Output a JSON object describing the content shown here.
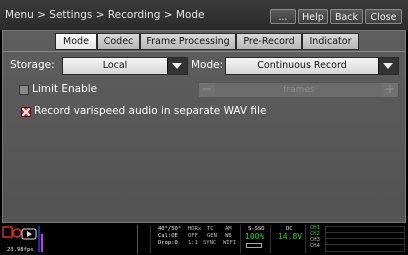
{
  "header": {
    "breadcrumb": "Menu > Settings > Recording > Mode",
    "buttons": {
      "more": "...",
      "help": "Help",
      "back": "Back",
      "close": "Close"
    }
  },
  "tabs": [
    "Mode",
    "Codec",
    "Frame Processing",
    "Pre-Record",
    "Indicator"
  ],
  "active_tab": "Mode",
  "form": {
    "storage_label": "Storage:",
    "storage_value": "Local",
    "mode_label": "Mode:",
    "mode_value": "Continuous Record",
    "limit_enable_label": "Limit Enable",
    "limit_enable_checked": false,
    "frames_placeholder": "frames",
    "frames_minus": "−",
    "frames_plus": "+",
    "varispeed_label": "Record varispeed audio in separate WAV file",
    "varispeed_checked": true
  },
  "status": {
    "timecode_label": "23.98fps",
    "iso": "40°/50°",
    "cal": "Cal:OE",
    "drop": "Drop:0",
    "hdrx": "HDRx",
    "tc": "TC",
    "am": "AM",
    "off": "OFF",
    "gen": "GEN",
    "wb": "WB",
    "ratio": "1:1",
    "sync": "SYNC",
    "wifi": "WIFI",
    "ssd_label": "S-SSD",
    "ssd_value": "100%",
    "dc_label": "DC",
    "dc_value": "14.8V",
    "ch1": "CH1",
    "ch2": "CH2",
    "ch3": "CH3",
    "ch4": "CH4",
    "colors": {
      "accent_red": "#d22c2c",
      "status_green": "#2bd52b",
      "status_blue": "#9fb8ff"
    }
  }
}
